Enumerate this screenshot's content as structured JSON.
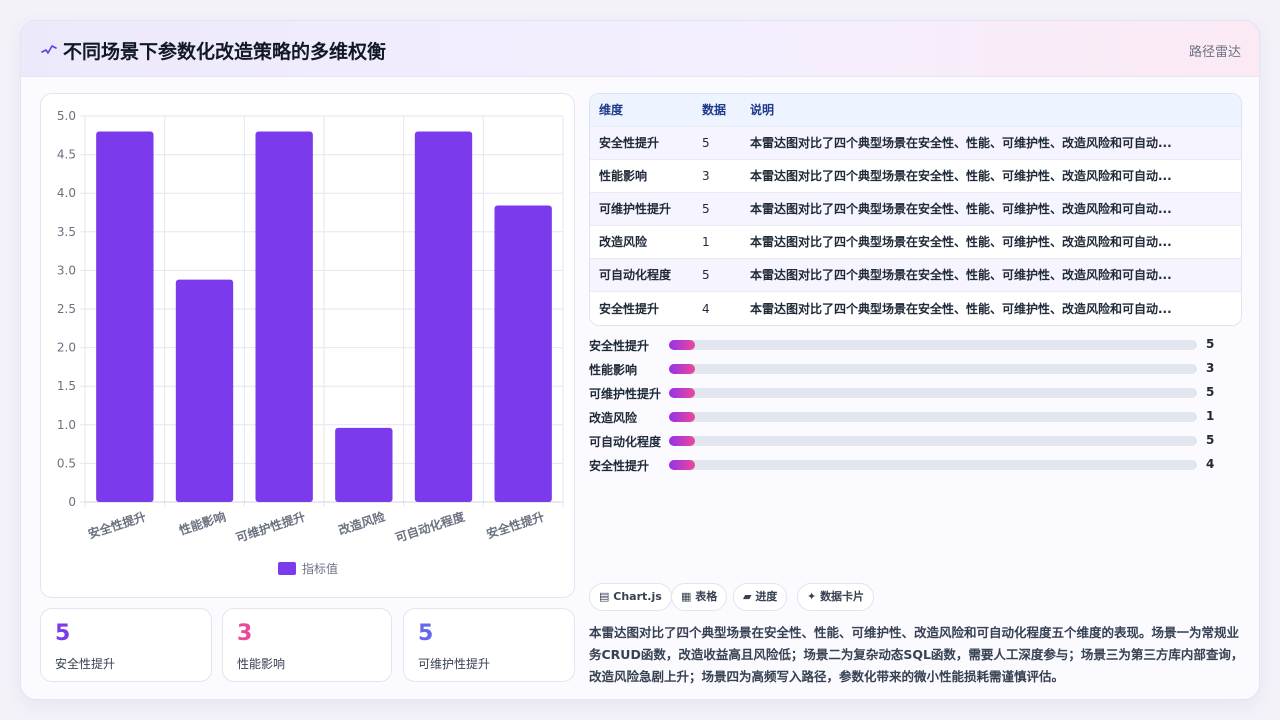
{
  "header": {
    "title": "不同场景下参数化改造策略的多维权衡",
    "badge": "路径雷达",
    "icon": "signal-icon"
  },
  "chart_data": {
    "type": "bar",
    "categories": [
      "安全性提升",
      "性能影响",
      "可维护性提升",
      "改造风险",
      "可自动化程度",
      "安全性提升"
    ],
    "series": [
      {
        "name": "指标值",
        "values": [
          4.8,
          2.88,
          4.8,
          0.96,
          4.8,
          3.84
        ],
        "color": "#7c3aed"
      }
    ],
    "ylim": [
      0,
      5
    ],
    "yticks": [
      "0",
      "0.5",
      "1.0",
      "1.5",
      "2.0",
      "2.5",
      "3.0",
      "3.5",
      "4.0",
      "4.5",
      "5.0"
    ],
    "grid": true,
    "legend": "bottom"
  },
  "stats": [
    {
      "value": "5",
      "label": "安全性提升",
      "color": "#7c3aed"
    },
    {
      "value": "3",
      "label": "性能影响",
      "color": "#ec4899"
    },
    {
      "value": "5",
      "label": "可维护性提升",
      "color": "#6366f1"
    }
  ],
  "table": {
    "headers": [
      "维度",
      "数据",
      "说明"
    ],
    "rows": [
      [
        "安全性提升",
        "5",
        "本雷达图对比了四个典型场景在安全性、性能、可维护性、改造风险和可自动..."
      ],
      [
        "性能影响",
        "3",
        "本雷达图对比了四个典型场景在安全性、性能、可维护性、改造风险和可自动..."
      ],
      [
        "可维护性提升",
        "5",
        "本雷达图对比了四个典型场景在安全性、性能、可维护性、改造风险和可自动..."
      ],
      [
        "改造风险",
        "1",
        "本雷达图对比了四个典型场景在安全性、性能、可维护性、改造风险和可自动..."
      ],
      [
        "可自动化程度",
        "5",
        "本雷达图对比了四个典型场景在安全性、性能、可维护性、改造风险和可自动..."
      ],
      [
        "安全性提升",
        "4",
        "本雷达图对比了四个典型场景在安全性、性能、可维护性、改造风险和可自动..."
      ]
    ]
  },
  "progress": [
    {
      "label": "安全性提升",
      "value": "5",
      "fill": 0.05
    },
    {
      "label": "性能影响",
      "value": "3",
      "fill": 0.05
    },
    {
      "label": "可维护性提升",
      "value": "5",
      "fill": 0.05
    },
    {
      "label": "改造风险",
      "value": "1",
      "fill": 0.05
    },
    {
      "label": "可自动化程度",
      "value": "5",
      "fill": 0.05
    },
    {
      "label": "安全性提升",
      "value": "4",
      "fill": 0.05
    }
  ],
  "tags": [
    {
      "icon": "monitor-icon",
      "glyph": "▤",
      "label": "Chart.js"
    },
    {
      "icon": "table-icon",
      "glyph": "▦",
      "label": "表格"
    },
    {
      "icon": "progress-icon",
      "glyph": "▰",
      "label": "进度"
    },
    {
      "icon": "sparkle-icon",
      "glyph": "✦",
      "label": "数据卡片"
    }
  ],
  "summary": "本雷达图对比了四个典型场景在安全性、性能、可维护性、改造风险和可自动化程度五个维度的表现。场景一为常规业务CRUD函数，改造收益高且风险低；场景二为复杂动态SQL函数，需要人工深度参与；场景三为第三方库内部查询，改造风险急剧上升；场景四为高频写入路径，参数化带来的微小性能损耗需谨慎评估。"
}
